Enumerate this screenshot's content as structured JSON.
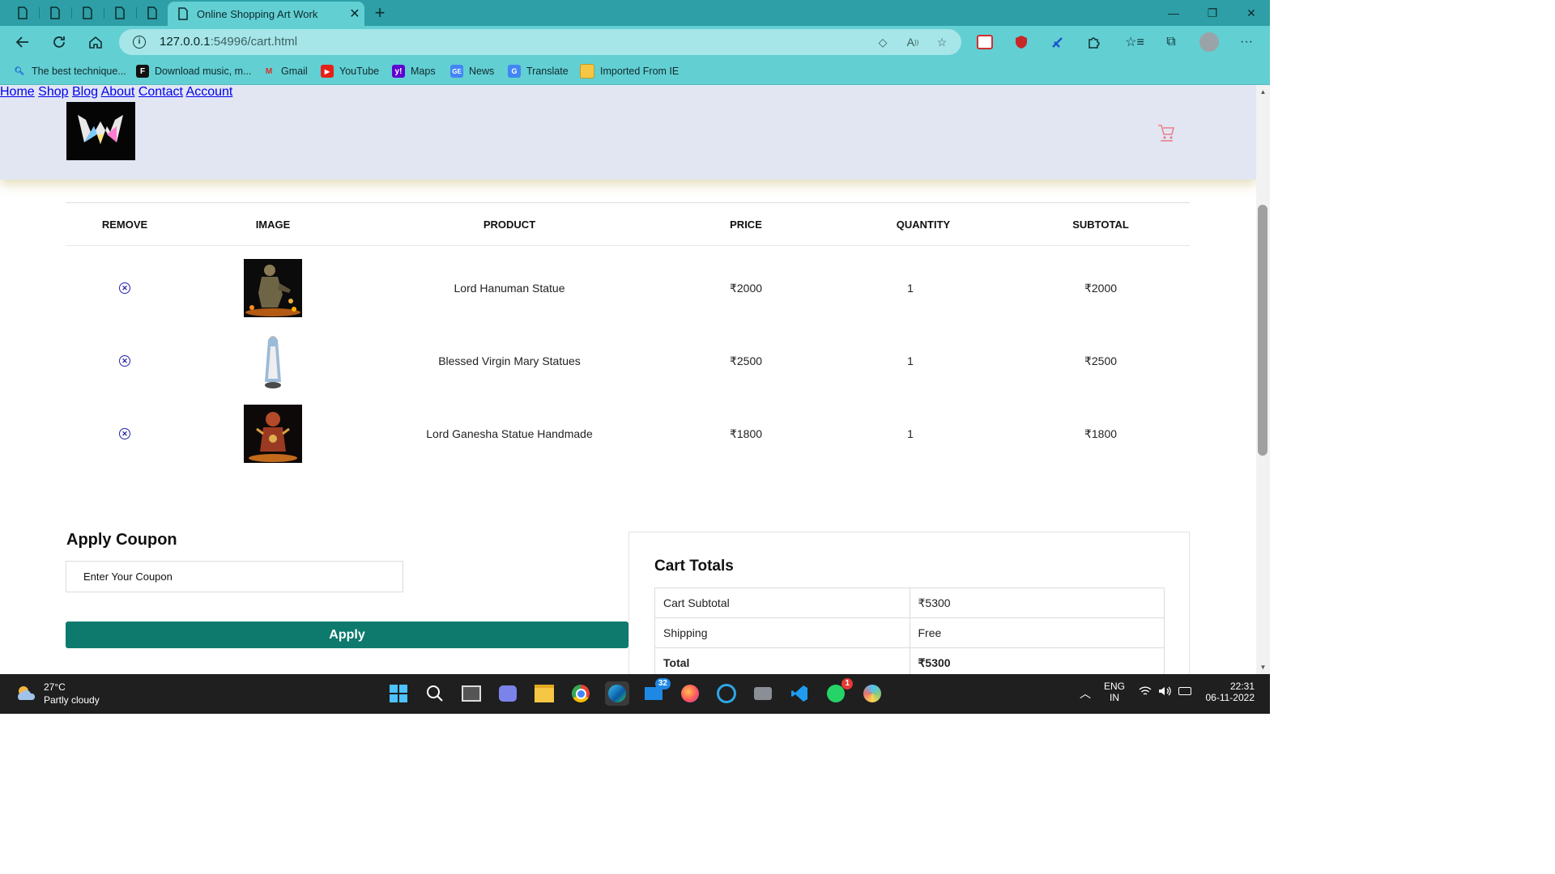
{
  "browser": {
    "tab_title": "Online Shopping Art Work",
    "url_prefix": "127.0.0.1",
    "url_rest": ":54996/cart.html",
    "bookmarks": [
      {
        "label": "The best technique...",
        "icon": "search-icon"
      },
      {
        "label": "Download music, m...",
        "icon": "f-logo-icon"
      },
      {
        "label": "Gmail",
        "icon": "gmail-icon"
      },
      {
        "label": "YouTube",
        "icon": "youtube-icon"
      },
      {
        "label": "Maps",
        "icon": "yahoo-icon"
      },
      {
        "label": "News",
        "icon": "news-icon"
      },
      {
        "label": "Translate",
        "icon": "translate-icon"
      },
      {
        "label": "Imported From IE",
        "icon": "folder-icon"
      }
    ]
  },
  "site": {
    "nav": [
      "Home",
      "Shop",
      "Blog",
      "About",
      "Contact",
      "Account"
    ],
    "accent": "#e8828a"
  },
  "cart": {
    "headers": [
      "REMOVE",
      "IMAGE",
      "PRODUCT",
      "PRICE",
      "QUANTITY",
      "SUBTOTAL"
    ],
    "items": [
      {
        "product": "Lord Hanuman Statue",
        "price": "₹2000",
        "quantity": "1",
        "subtotal": "₹2000"
      },
      {
        "product": "Blessed Virgin Mary Statues",
        "price": "₹2500",
        "quantity": "1",
        "subtotal": "₹2500"
      },
      {
        "product": "Lord Ganesha Statue Handmade",
        "price": "₹1800",
        "quantity": "1",
        "subtotal": "₹1800"
      }
    ]
  },
  "coupon": {
    "title": "Apply Coupon",
    "placeholder": "Enter Your Coupon",
    "button": "Apply",
    "button_color": "#0e7a6e"
  },
  "totals": {
    "title": "Cart Totals",
    "rows": [
      {
        "label": "Cart Subtotal",
        "value": "₹5300"
      },
      {
        "label": "Shipping",
        "value": "Free"
      },
      {
        "label": "Total",
        "value": "₹5300"
      }
    ]
  },
  "taskbar": {
    "temperature": "27°C",
    "weather": "Partly cloudy",
    "mail_badge": "32",
    "whatsapp_badge": "1",
    "lang": "ENG",
    "region": "IN",
    "time": "22:31",
    "date": "06-11-2022"
  }
}
